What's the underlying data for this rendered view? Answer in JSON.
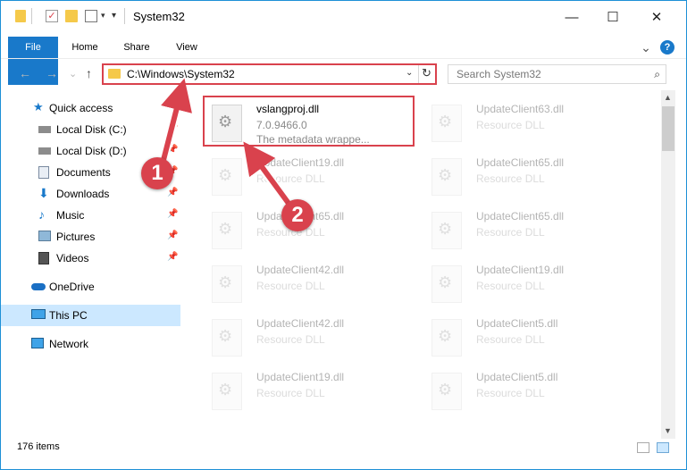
{
  "window": {
    "title": "System32"
  },
  "window_controls": {
    "minimize": "—",
    "maximize": "☐",
    "close": "✕"
  },
  "ribbon": {
    "tabs": [
      {
        "label": "File"
      },
      {
        "label": "Home"
      },
      {
        "label": "Share"
      },
      {
        "label": "View"
      }
    ],
    "expand": "⌄",
    "help": "?"
  },
  "address": {
    "path": "C:\\Windows\\System32",
    "dropdown": "⌄",
    "refresh": "↻"
  },
  "search": {
    "placeholder": "Search System32",
    "icon": "⌕"
  },
  "nav_buttons": {
    "back": "←",
    "forward": "→",
    "recent": "⌄",
    "up": "↑"
  },
  "sidebar": {
    "items": [
      {
        "label": "Quick access",
        "icon": "star-icon",
        "pinned": false
      },
      {
        "label": "Local Disk (C:)",
        "icon": "drive-icon",
        "pinned": true
      },
      {
        "label": "Local Disk (D:)",
        "icon": "drive-icon",
        "pinned": true
      },
      {
        "label": "Documents",
        "icon": "documents-icon",
        "pinned": true
      },
      {
        "label": "Downloads",
        "icon": "download-icon",
        "pinned": true
      },
      {
        "label": "Music",
        "icon": "music-icon",
        "pinned": true
      },
      {
        "label": "Pictures",
        "icon": "pictures-icon",
        "pinned": true
      },
      {
        "label": "Videos",
        "icon": "videos-icon",
        "pinned": true
      },
      {
        "label": "OneDrive",
        "icon": "cloud-icon",
        "pinned": false
      },
      {
        "label": "This PC",
        "icon": "computer-icon",
        "pinned": false,
        "selected": true
      },
      {
        "label": "Network",
        "icon": "network-icon",
        "pinned": false
      }
    ],
    "pin_glyph": "📌"
  },
  "files": {
    "highlighted": {
      "name": "vslangproj.dll",
      "version": "7.0.9466.0",
      "description": "The metadata wrappe..."
    },
    "faded": [
      {
        "name": "UpdateClient63.dll",
        "type": "Resource DLL"
      },
      {
        "name": "UpdateClient19.dll",
        "type": "Resource DLL"
      },
      {
        "name": "UpdateClient65.dll",
        "type": "Resource DLL"
      },
      {
        "name": "UpdateClient65.dll",
        "type": "Resource DLL"
      },
      {
        "name": "UpdateClient65.dll",
        "type": "Resource DLL"
      },
      {
        "name": "UpdateClient42.dll",
        "type": "Resource DLL"
      },
      {
        "name": "UpdateClient19.dll",
        "type": "Resource DLL"
      },
      {
        "name": "UpdateClient42.dll",
        "type": "Resource DLL"
      },
      {
        "name": "UpdateClient5.dll",
        "type": "Resource DLL"
      },
      {
        "name": "UpdateClient19.dll",
        "type": "Resource DLL"
      },
      {
        "name": "UpdateClient5.dll",
        "type": "Resource DLL"
      }
    ]
  },
  "status": {
    "item_count": "176 items"
  },
  "annotations": {
    "step1": "1",
    "step2": "2",
    "color": "#d9424d"
  }
}
